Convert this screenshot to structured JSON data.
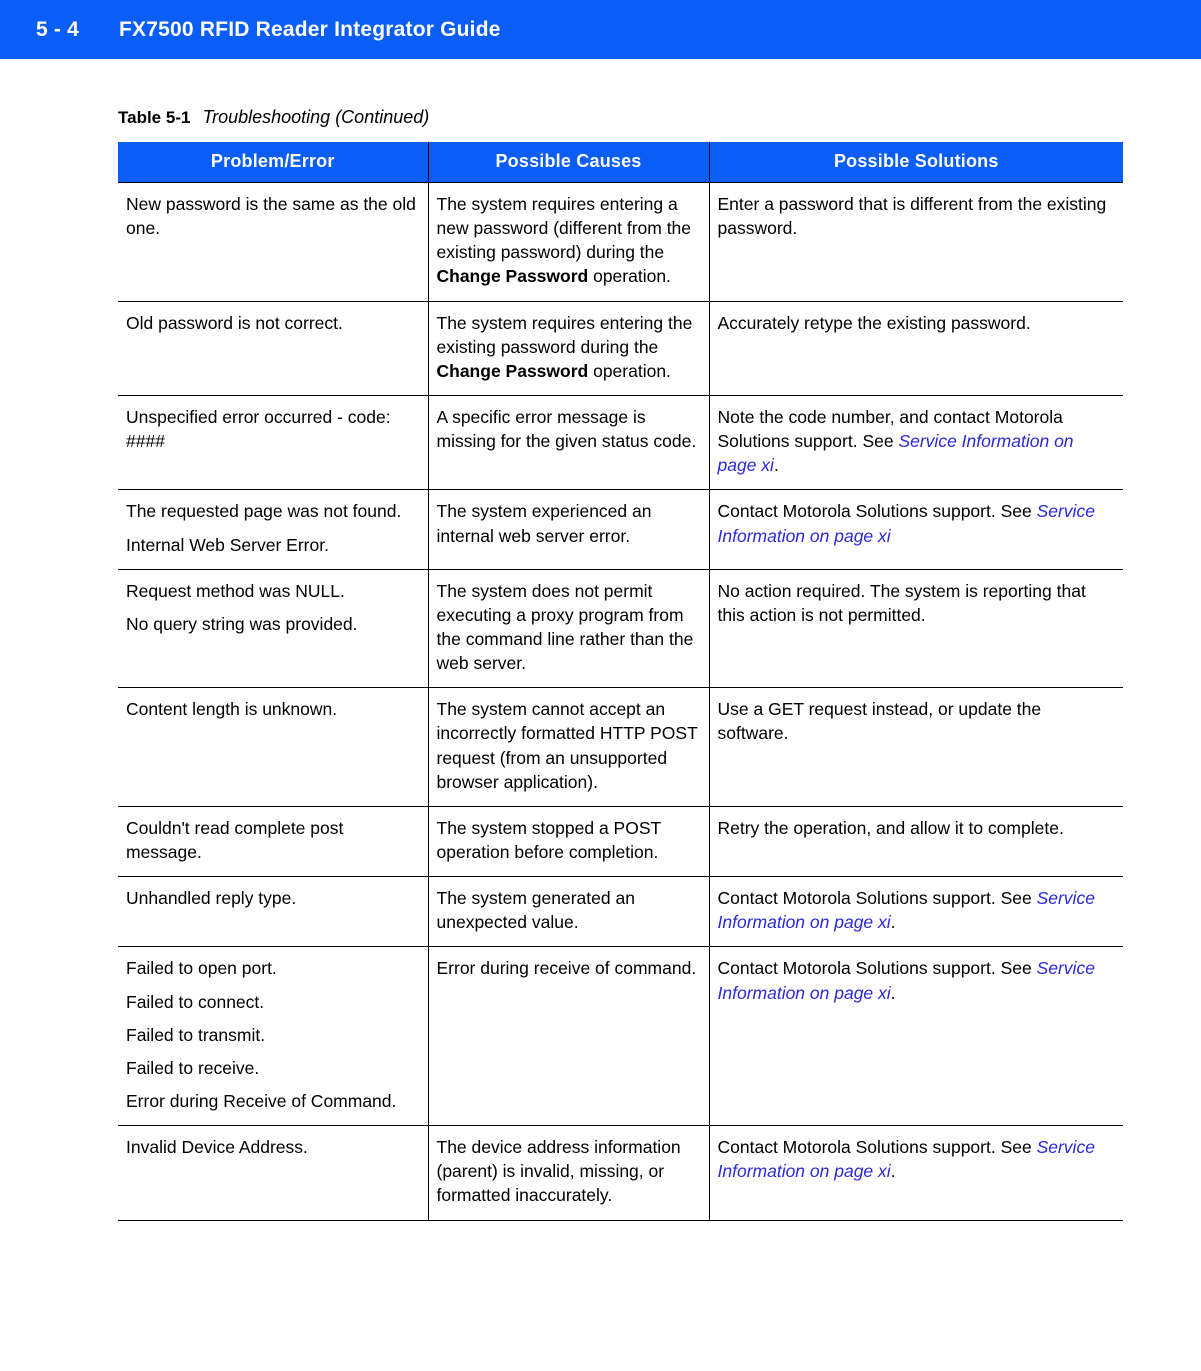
{
  "header": {
    "folio": "5 - 4",
    "book_title": "FX7500 RFID Reader Integrator Guide",
    "band_color": "#0a5df5",
    "text_color": "#ffffff"
  },
  "caption": {
    "number": "Table 5-1",
    "title": "Troubleshooting (Continued)"
  },
  "table": {
    "header_bg": "#0a5df5",
    "header_fg": "#ffffff",
    "link_color": "#2b29d8",
    "columns": [
      "Problem/Error",
      "Possible Causes",
      "Possible Solutions"
    ],
    "rows": [
      {
        "problem_lines": [
          "New password is the same as the old one."
        ],
        "cause_pre": "The system requires entering a new password (different from the existing password) during the ",
        "cause_bold": "Change Password",
        "cause_post": " operation.",
        "solution_pre": "Enter a password that is different from the existing password.",
        "solution_link": "",
        "solution_post": ""
      },
      {
        "problem_lines": [
          "Old password is not correct."
        ],
        "cause_pre": "The system requires entering the existing password during the ",
        "cause_bold": "Change Password",
        "cause_post": " operation.",
        "solution_pre": "Accurately retype the existing password.",
        "solution_link": "",
        "solution_post": ""
      },
      {
        "problem_lines": [
          "Unspecified error occurred - code: ####"
        ],
        "cause_pre": "A specific error message is missing for the given status code.",
        "cause_bold": "",
        "cause_post": "",
        "solution_pre": "Note the code number, and contact Motorola Solutions support. See ",
        "solution_link": "Service Information on page xi",
        "solution_post": "."
      },
      {
        "problem_lines": [
          "The requested page was not found.",
          "Internal Web Server Error."
        ],
        "cause_pre": "The system experienced an internal web server error.",
        "cause_bold": "",
        "cause_post": "",
        "solution_pre": "Contact Motorola Solutions support. See ",
        "solution_link": "Service Information on page xi",
        "solution_post": ""
      },
      {
        "problem_lines": [
          "Request method was NULL.",
          "No query string was provided."
        ],
        "cause_pre": "The system does not permit executing a proxy program from the command line rather than the web server.",
        "cause_bold": "",
        "cause_post": "",
        "solution_pre": "No action required. The system is reporting that this action is not permitted.",
        "solution_link": "",
        "solution_post": ""
      },
      {
        "problem_lines": [
          "Content length is unknown."
        ],
        "cause_pre": "The system cannot accept an incorrectly formatted HTTP POST request (from an unsupported browser application).",
        "cause_bold": "",
        "cause_post": "",
        "solution_pre": "Use a GET request instead, or update the software.",
        "solution_link": "",
        "solution_post": ""
      },
      {
        "problem_lines": [
          "Couldn't read complete post message."
        ],
        "cause_pre": "The system stopped a POST operation before completion.",
        "cause_bold": "",
        "cause_post": "",
        "solution_pre": "Retry the operation, and allow it to complete.",
        "solution_link": "",
        "solution_post": ""
      },
      {
        "problem_lines": [
          "Unhandled reply type."
        ],
        "cause_pre": "The system generated an unexpected value.",
        "cause_bold": "",
        "cause_post": "",
        "solution_pre": "Contact Motorola Solutions support. See ",
        "solution_link": "Service Information on page xi",
        "solution_post": "."
      },
      {
        "problem_lines": [
          "Failed to open port.",
          "Failed to connect.",
          "Failed to transmit.",
          "Failed to receive.",
          "Error during Receive of Command."
        ],
        "cause_pre": "Error during receive of command.",
        "cause_bold": "",
        "cause_post": "",
        "solution_pre": "Contact Motorola Solutions support. See ",
        "solution_link": "Service Information on page xi",
        "solution_post": "."
      },
      {
        "problem_lines": [
          "Invalid Device Address."
        ],
        "cause_pre": "The device address information (parent) is invalid, missing, or formatted inaccurately.",
        "cause_bold": "",
        "cause_post": "",
        "solution_pre": "Contact Motorola Solutions support. See ",
        "solution_link": "Service Information on page xi",
        "solution_post": "."
      }
    ]
  }
}
